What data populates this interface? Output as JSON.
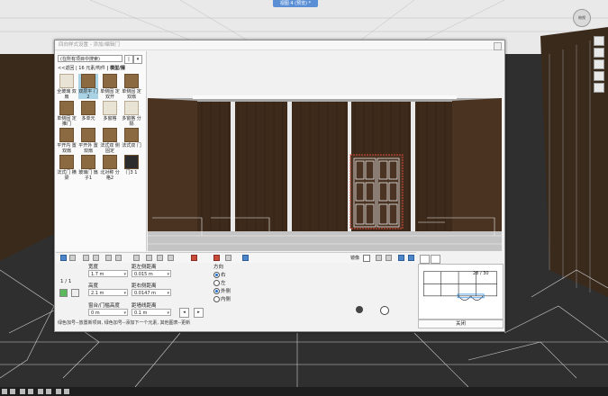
{
  "window": {
    "view_tab": "视图 4 (预览) *",
    "nav_cube": "俯视"
  },
  "dialog": {
    "title": "四向样式设置 - 添加/编辑门",
    "library_select": "(在所有项目中搜索)",
    "library_btn_a": "|",
    "library_btn_b": "▾",
    "breadcrumb_back": "<<返回",
    "breadcrumb_count": "| 16 元素/构件",
    "breadcrumb_path": "| 模型/摆",
    "tiles": [
      {
        "label": "全玻璃 双扇",
        "style": "light"
      },
      {
        "label": "双层平 门2",
        "style": "wood",
        "selected": true
      },
      {
        "label": "单侧固 定双开",
        "style": "wood"
      },
      {
        "label": "单侧固 定双扇",
        "style": "wood"
      },
      {
        "label": "单侧固 定推门",
        "style": "wood"
      },
      {
        "label": "多单元",
        "style": "wood"
      },
      {
        "label": "多窗格",
        "style": "light"
      },
      {
        "label": "多窗格 分隔",
        "style": "light"
      },
      {
        "label": "平开内 置双扇",
        "style": "wood"
      },
      {
        "label": "平开外 置双扇",
        "style": "wood"
      },
      {
        "label": "法式双 侧固定",
        "style": "wood"
      },
      {
        "label": "法式双 门",
        "style": "wood"
      },
      {
        "label": "法式门 横梁",
        "style": "wood"
      },
      {
        "label": "玻璃门 扇子1",
        "style": "wood"
      },
      {
        "label": "北对称 分格2",
        "style": "wood"
      },
      {
        "label": "门3 1",
        "style": "dark"
      }
    ],
    "mirror_label": "镜像",
    "page_indicator": "1 / 1",
    "fields": {
      "width_label": "宽度",
      "width_value": "1.7 m",
      "left_offset_label": "距左侧距离",
      "left_offset_value": "0.015 m",
      "height_label": "高度",
      "height_value": "2.1 m",
      "right_offset_label": "距右侧距离",
      "right_offset_value": "0.0147 m",
      "sill_label": "窗台/门槛高度",
      "sill_value": "0 m",
      "offset_label": "距墙线距离",
      "offset_value": "0.1 m"
    },
    "direction": {
      "label": "方向",
      "options": [
        {
          "label": "右",
          "checked": true
        },
        {
          "label": "左",
          "checked": false
        },
        {
          "label": "外侧",
          "checked": true
        },
        {
          "label": "内侧",
          "checked": false
        }
      ]
    },
    "hint": "绿色加号--放置新项目, 绿色加号--添加下一个元素, 其他图表--更新",
    "thumb_count": "28 / 30",
    "close_label": "关闭"
  }
}
